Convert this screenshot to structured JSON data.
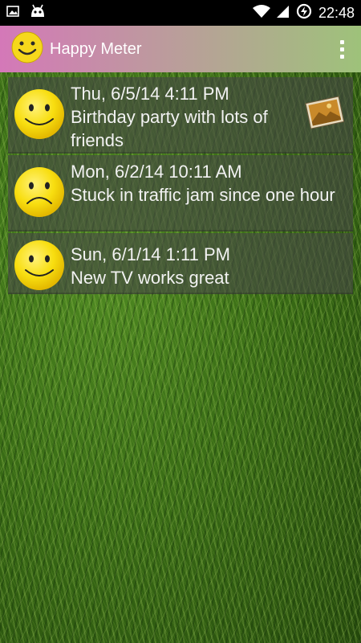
{
  "status_bar": {
    "time": "22:48",
    "icons": [
      "image-icon",
      "android-icon",
      "wifi-icon",
      "signal-icon",
      "battery-charging-icon"
    ]
  },
  "app": {
    "title": "Happy Meter",
    "logo_icon": "smiley-logo-icon",
    "menu_icon": "overflow-menu-icon",
    "accent_gradient": [
      "#d478b8",
      "#9ec27a"
    ]
  },
  "entries": [
    {
      "date": "Thu, 6/5/14 4:11 PM",
      "text": "Birthday party with lots of friends",
      "mood": "happy",
      "has_photo": true
    },
    {
      "date": "Mon, 6/2/14 10:11 AM",
      "text": "Stuck in traffic jam since one hour",
      "mood": "sad",
      "has_photo": false
    },
    {
      "date": "Sun, 6/1/14 1:11 PM",
      "text": "New TV works great",
      "mood": "happy",
      "has_photo": false
    }
  ]
}
